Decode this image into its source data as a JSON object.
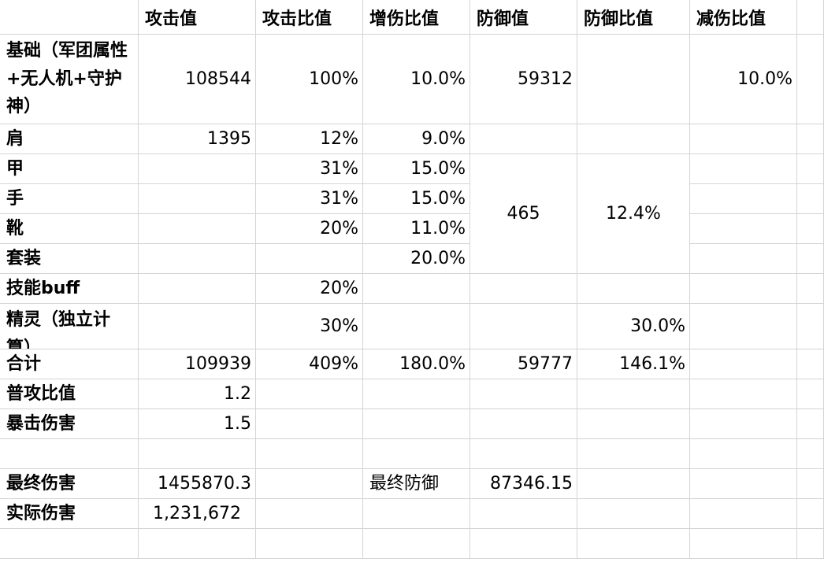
{
  "header": [
    "",
    "攻击值",
    "攻击比值",
    "增伤比值",
    "防御值",
    "防御比值",
    "减伤比值",
    ""
  ],
  "rows": [
    [
      "基础（军团属性+无人机+守护神）",
      "108544",
      "100%",
      "10.0%",
      "59312",
      "",
      "10.0%",
      ""
    ],
    [
      "肩",
      "1395",
      "12%",
      "9.0%",
      "",
      "",
      "",
      ""
    ],
    [
      "甲",
      "",
      "31%",
      "15.0%",
      "",
      "",
      "",
      ""
    ],
    [
      "手",
      "",
      "31%",
      "15.0%",
      "",
      "",
      "",
      ""
    ],
    [
      "靴",
      "",
      "20%",
      "11.0%",
      "",
      "",
      "",
      ""
    ],
    [
      "套装",
      "",
      "",
      "20.0%",
      "",
      "",
      "",
      ""
    ],
    [
      "技能buff",
      "",
      "20%",
      "",
      "",
      "",
      "",
      ""
    ],
    [
      "精灵（独立计算）",
      "",
      "30%",
      "",
      "",
      "30.0%",
      "",
      ""
    ],
    [
      "合计",
      "109939",
      "409%",
      "180.0%",
      "59777",
      "146.1%",
      "",
      ""
    ],
    [
      "普攻比值",
      "1.2",
      "",
      "",
      "",
      "",
      "",
      ""
    ],
    [
      "暴击伤害",
      "1.5",
      "",
      "",
      "",
      "",
      "",
      ""
    ],
    [
      "",
      "",
      "",
      "",
      "",
      "",
      "",
      ""
    ],
    [
      "最终伤害",
      "1455870.3",
      "",
      "最终防御",
      "87346.15",
      "",
      "",
      ""
    ],
    [
      "实际伤害",
      "1,231,672",
      "",
      "",
      "",
      "",
      "",
      ""
    ],
    [
      "",
      "",
      "",
      "",
      "",
      "",
      "",
      ""
    ]
  ],
  "merged": {
    "armor_defense": "465",
    "armor_defense_ratio": "12.4%"
  }
}
